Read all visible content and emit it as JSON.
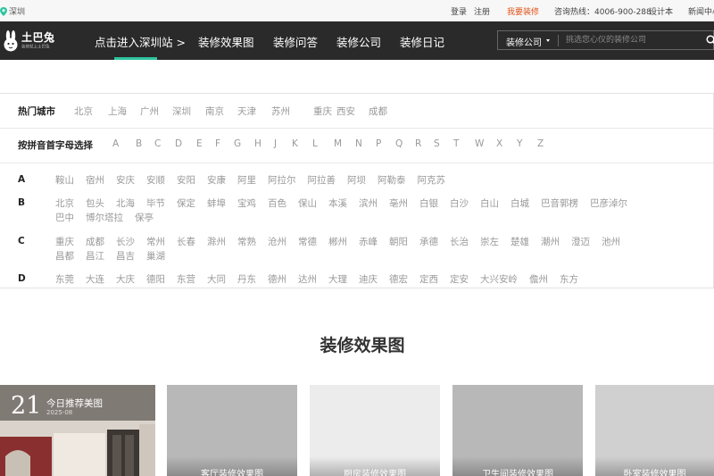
{
  "topbar": {
    "city": "深圳",
    "links": [
      {
        "label": "登录",
        "hot": false
      },
      {
        "label": "注册",
        "hot": false
      },
      {
        "label": "我要装修",
        "hot": true
      },
      {
        "label": "咨询热线：4006-900-288",
        "hot": false
      },
      {
        "label": "设计本",
        "hot": false
      },
      {
        "label": "新闻中心",
        "hot": false
      }
    ]
  },
  "header": {
    "logo_text": "土巴兔",
    "logo_sub": "装修就上土巴兔",
    "nav": [
      "点击进入深圳站 >",
      "装修效果图",
      "装修问答",
      "装修公司",
      "装修日记"
    ],
    "search": {
      "type_label": "装修公司",
      "placeholder": "挑选您心仪的装修公司"
    }
  },
  "city_panel": {
    "hot_label": "热门城市",
    "hot_cities": [
      "北京",
      "上海",
      "广州",
      "深圳",
      "南京",
      "天津",
      "苏州",
      "重庆",
      "西安",
      "成都"
    ],
    "letter_label": "按拼音首字母选择",
    "letters": [
      "A",
      "B",
      "C",
      "D",
      "E",
      "F",
      "G",
      "H",
      "J",
      "K",
      "L",
      "M",
      "N",
      "P",
      "Q",
      "R",
      "S",
      "T",
      "W",
      "X",
      "Y",
      "Z"
    ],
    "groups": [
      {
        "letter": "A",
        "lines": [
          [
            "鞍山",
            "宿州",
            "安庆",
            "安顺",
            "安阳",
            "安康",
            "阿里",
            "阿拉尔",
            "阿拉善",
            "阿坝",
            "阿勒泰",
            "阿克苏"
          ]
        ]
      },
      {
        "letter": "B",
        "lines": [
          [
            "北京",
            "包头",
            "北海",
            "毕节",
            "保定",
            "蚌埠",
            "宝鸡",
            "百色",
            "保山",
            "本溪",
            "滨州",
            "亳州",
            "白银",
            "白沙",
            "白山",
            "白城",
            "巴音郭楞",
            "巴彦淖尔"
          ],
          [
            "巴中",
            "博尔塔拉",
            "保亭"
          ]
        ]
      },
      {
        "letter": "C",
        "lines": [
          [
            "重庆",
            "成都",
            "长沙",
            "常州",
            "长春",
            "滁州",
            "常熟",
            "沧州",
            "常德",
            "郴州",
            "赤峰",
            "朝阳",
            "承德",
            "长治",
            "崇左",
            "楚雄",
            "潮州",
            "澄迈",
            "池州"
          ],
          [
            "昌都",
            "昌江",
            "昌吉",
            "巢湖"
          ]
        ]
      },
      {
        "letter": "D",
        "lines": [
          [
            "东莞",
            "大连",
            "大庆",
            "德阳",
            "东营",
            "大同",
            "丹东",
            "德州",
            "达州",
            "大理",
            "迪庆",
            "德宏",
            "定西",
            "定安",
            "大兴安岭",
            "儋州",
            "东方"
          ]
        ]
      }
    ]
  },
  "section": {
    "title": "装修效果图"
  },
  "cards": {
    "featured": {
      "day": "21",
      "label": "今日推荐美图",
      "date": "2025-08"
    },
    "items": [
      "客厅装修效果图",
      "厨房装修效果图",
      "卫生间装修效果图",
      "卧室装修效果图",
      ""
    ]
  }
}
